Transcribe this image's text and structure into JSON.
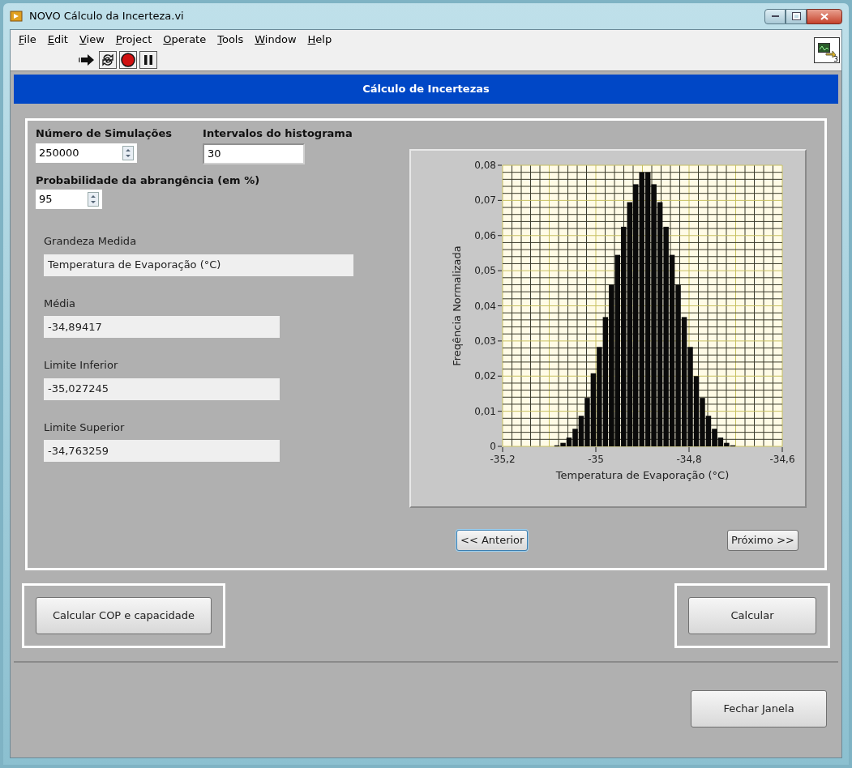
{
  "window": {
    "title": "NOVO Cálculo da Incerteza.vi"
  },
  "menu": [
    "File",
    "Edit",
    "View",
    "Project",
    "Operate",
    "Tools",
    "Window",
    "Help"
  ],
  "vi_icon": {
    "badge": "3"
  },
  "header": {
    "title": "Cálculo de Incertezas"
  },
  "inputs": [
    {
      "kind": "spin",
      "label": "Número de Simulações",
      "value": "250000"
    },
    {
      "kind": "plain",
      "label": "Intervalos do histograma",
      "value": "30"
    },
    {
      "kind": "spin",
      "label": "Probabilidade da abrangência (em %)",
      "value": "95"
    }
  ],
  "outputs": [
    {
      "label": "Grandeza Medida",
      "value": "Temperatura de Evaporação (°C)",
      "wide": true
    },
    {
      "label": "Média",
      "value": "-34,89417",
      "wide": false
    },
    {
      "label": "Limite Inferior",
      "value": "-35,027245",
      "wide": false
    },
    {
      "label": "Limite Superior",
      "value": "-34,763259",
      "wide": false
    }
  ],
  "chart": {
    "chart_data": {
      "type": "bar",
      "xlabel": "Temperatura de Evaporação (°C)",
      "ylabel": "Freqência Normalizada",
      "x": [
        -35.0825,
        -35.0695,
        -35.0565,
        -35.0435,
        -35.0305,
        -35.0175,
        -35.0045,
        -34.9915,
        -34.9785,
        -34.9655,
        -34.9525,
        -34.9395,
        -34.9265,
        -34.9135,
        -34.9005,
        -34.8875,
        -34.8745,
        -34.8615,
        -34.8485,
        -34.8355,
        -34.8225,
        -34.8095,
        -34.7965,
        -34.7835,
        -34.7705,
        -34.7575,
        -34.7445,
        -34.7315,
        -34.7185,
        -34.7055
      ],
      "values": [
        0.0003,
        0.001,
        0.0025,
        0.005,
        0.0087,
        0.0138,
        0.0208,
        0.0283,
        0.0368,
        0.046,
        0.0545,
        0.0625,
        0.0695,
        0.0746,
        0.078,
        0.078,
        0.0746,
        0.0695,
        0.0625,
        0.0545,
        0.046,
        0.0368,
        0.0283,
        0.02,
        0.0138,
        0.0087,
        0.005,
        0.0025,
        0.001,
        0.0003
      ],
      "grid": true,
      "xlim": [
        -35.2,
        -34.6
      ],
      "ylim": [
        0,
        0.08
      ],
      "xticks": [
        {
          "value": -35.2,
          "label": "-35,2"
        },
        {
          "value": -35,
          "label": "-35"
        },
        {
          "value": -34.8,
          "label": "-34,8"
        },
        {
          "value": -34.6,
          "label": "-34,6"
        }
      ],
      "yticks": [
        {
          "value": 0,
          "label": "0"
        },
        {
          "value": 0.01,
          "label": "0,01"
        },
        {
          "value": 0.02,
          "label": "0,02"
        },
        {
          "value": 0.03,
          "label": "0,03"
        },
        {
          "value": 0.04,
          "label": "0,04"
        },
        {
          "value": 0.05,
          "label": "0,05"
        },
        {
          "value": 0.06,
          "label": "0,06"
        },
        {
          "value": 0.07,
          "label": "0,07"
        },
        {
          "value": 0.08,
          "label": "0,08"
        }
      ]
    }
  },
  "nav": [
    {
      "label": "<< Anterior",
      "selected": true
    },
    {
      "label": "Próximo >>",
      "selected": false
    }
  ],
  "actions": [
    "Calcular COP e capacidade",
    "Calcular"
  ],
  "close_button": "Fechar Janela"
}
